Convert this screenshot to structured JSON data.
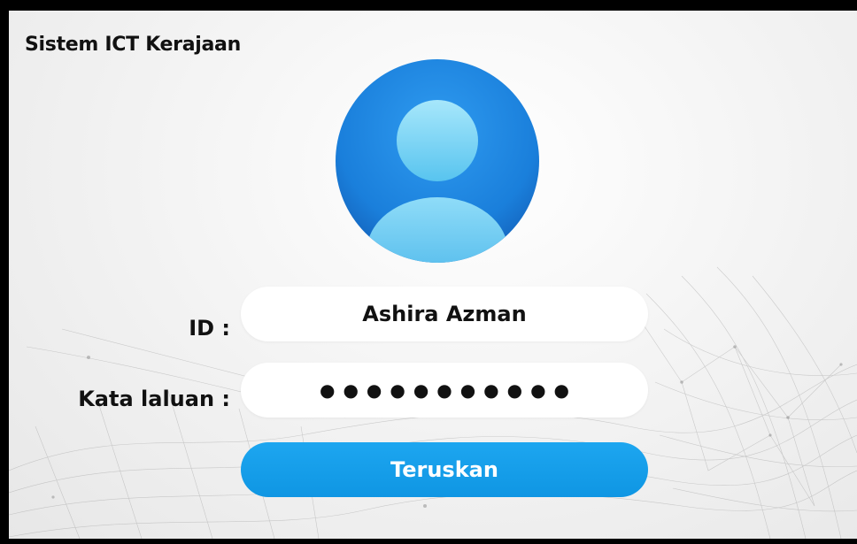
{
  "app": {
    "title": "Sistem ICT Kerajaan"
  },
  "avatar": {
    "icon": "user-avatar-icon",
    "colors": {
      "outer_top": "#1e88e5",
      "outer_bottom": "#1565c0",
      "figure_light": "#7fd6f6",
      "figure_dark": "#4bbdec"
    }
  },
  "form": {
    "id_label": "ID :",
    "id_value": "Ashira Azman",
    "password_label": "Kata laluan :",
    "password_value": "●●●●●●●●●●●",
    "submit_label": "Teruskan"
  },
  "theme": {
    "accent": "#1399e6",
    "background": "#f2f2f2",
    "border": "#000000"
  }
}
